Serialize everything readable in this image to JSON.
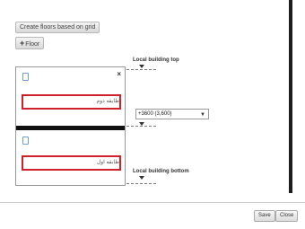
{
  "toolbar": {
    "create_floors_label": "Create floors based on grid",
    "add_floor_plus": "+",
    "add_floor_label": "Floor"
  },
  "levels": {
    "top_label": "Local building top",
    "bottom_label": "Local building bottom",
    "offset_select_value": "+3600 (3,600)"
  },
  "floors": [
    {
      "name": "طابقه دوم"
    },
    {
      "name": "طابقه اول"
    }
  ],
  "panel": {
    "close_glyph": "×"
  },
  "footer": {
    "save_label": "Save",
    "close_label": "Close"
  },
  "colors": {
    "highlight_border": "#d0202a",
    "accent_bar": "#1d1d1d"
  },
  "icons": [
    "document-icon",
    "close-icon",
    "chevron-down-icon",
    "plus-icon"
  ]
}
